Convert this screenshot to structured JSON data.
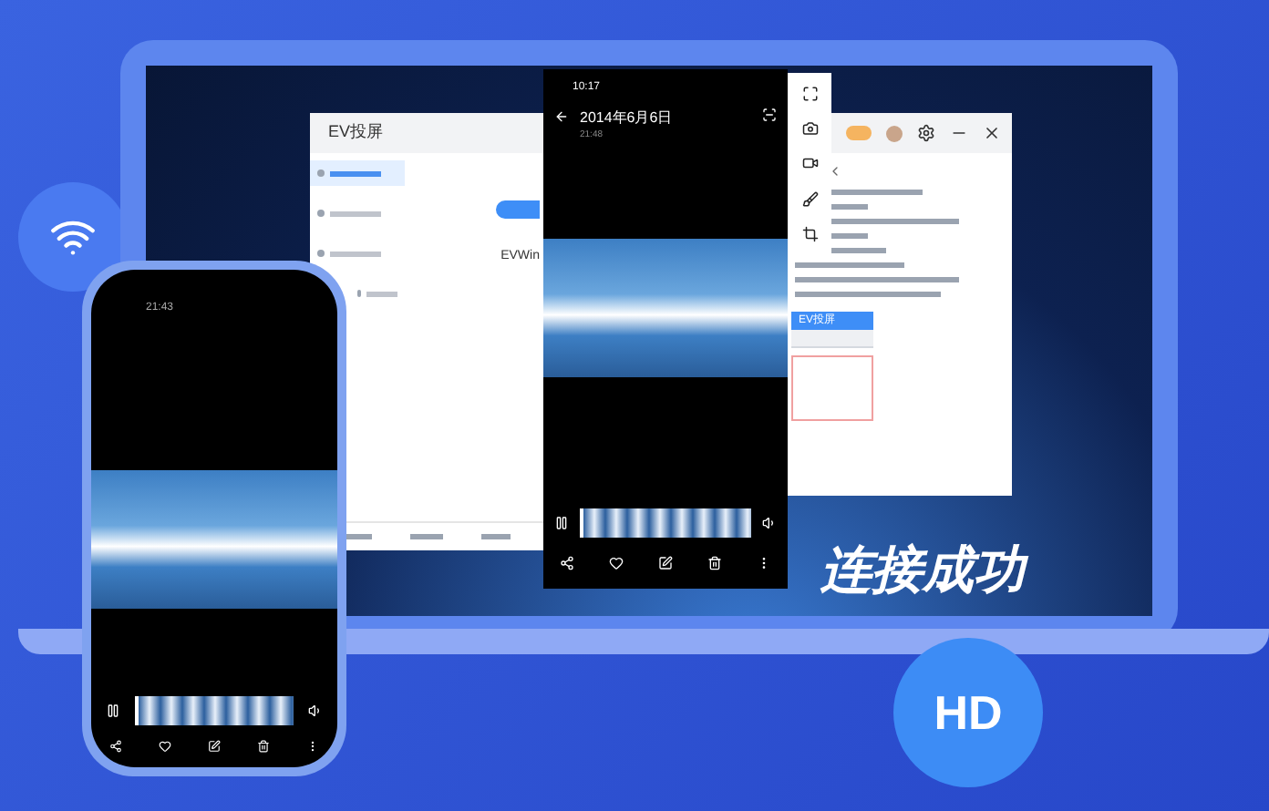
{
  "left_window": {
    "title": "EV投屏",
    "sidebar": [
      {
        "selected": true
      },
      {
        "selected": false
      },
      {
        "selected": false
      },
      {
        "selected": false
      }
    ],
    "label": "EVWin"
  },
  "center_phone": {
    "status_time": "10:17",
    "date": "2014年6月6日",
    "time": "21:48"
  },
  "right_window": {
    "tabs": [
      {
        "label": "EV投屏",
        "selected": true
      },
      {
        "selected": false
      }
    ]
  },
  "left_phone": {
    "status_time": "21:43"
  },
  "banner": "连接成功",
  "badge": "HD"
}
